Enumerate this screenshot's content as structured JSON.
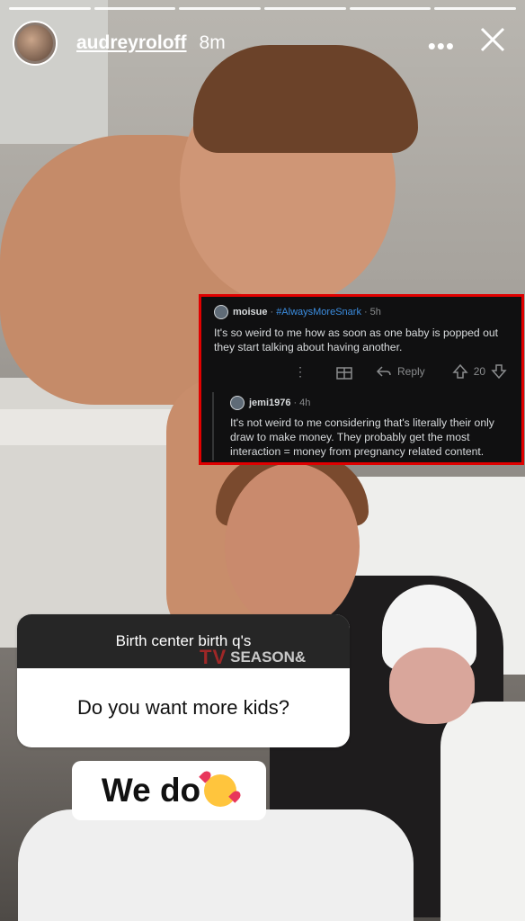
{
  "story": {
    "username": "audreyroloff",
    "time": "8m",
    "more_icon": "more-horizontal-icon",
    "close_icon": "close-icon",
    "segments": 6
  },
  "reddit": {
    "comment": {
      "user": "moisue",
      "flair": "#AlwaysMoreSnark",
      "age": "5h",
      "text": "It's so weird to me how as soon as one baby is popped out they start talking about having another.",
      "reply_label": "Reply",
      "score": "20"
    },
    "reply": {
      "user": "jemi1976",
      "age": "4h",
      "text": "It's not weird to me considering that's literally their only draw to make money. They probably get the most interaction = money from pregnancy related content."
    }
  },
  "question_sticker": {
    "prompt": "Birth center birth q's",
    "question": "Do you want more kids?"
  },
  "watermark": {
    "tv": "TV",
    "text": "SEASON&"
  },
  "answer": {
    "text": "We do",
    "emoji": "smiling-face-with-hearts-icon"
  },
  "colors": {
    "highlight_border": "#e00000",
    "reddit_bg": "#101011",
    "flair": "#3b8de0"
  }
}
